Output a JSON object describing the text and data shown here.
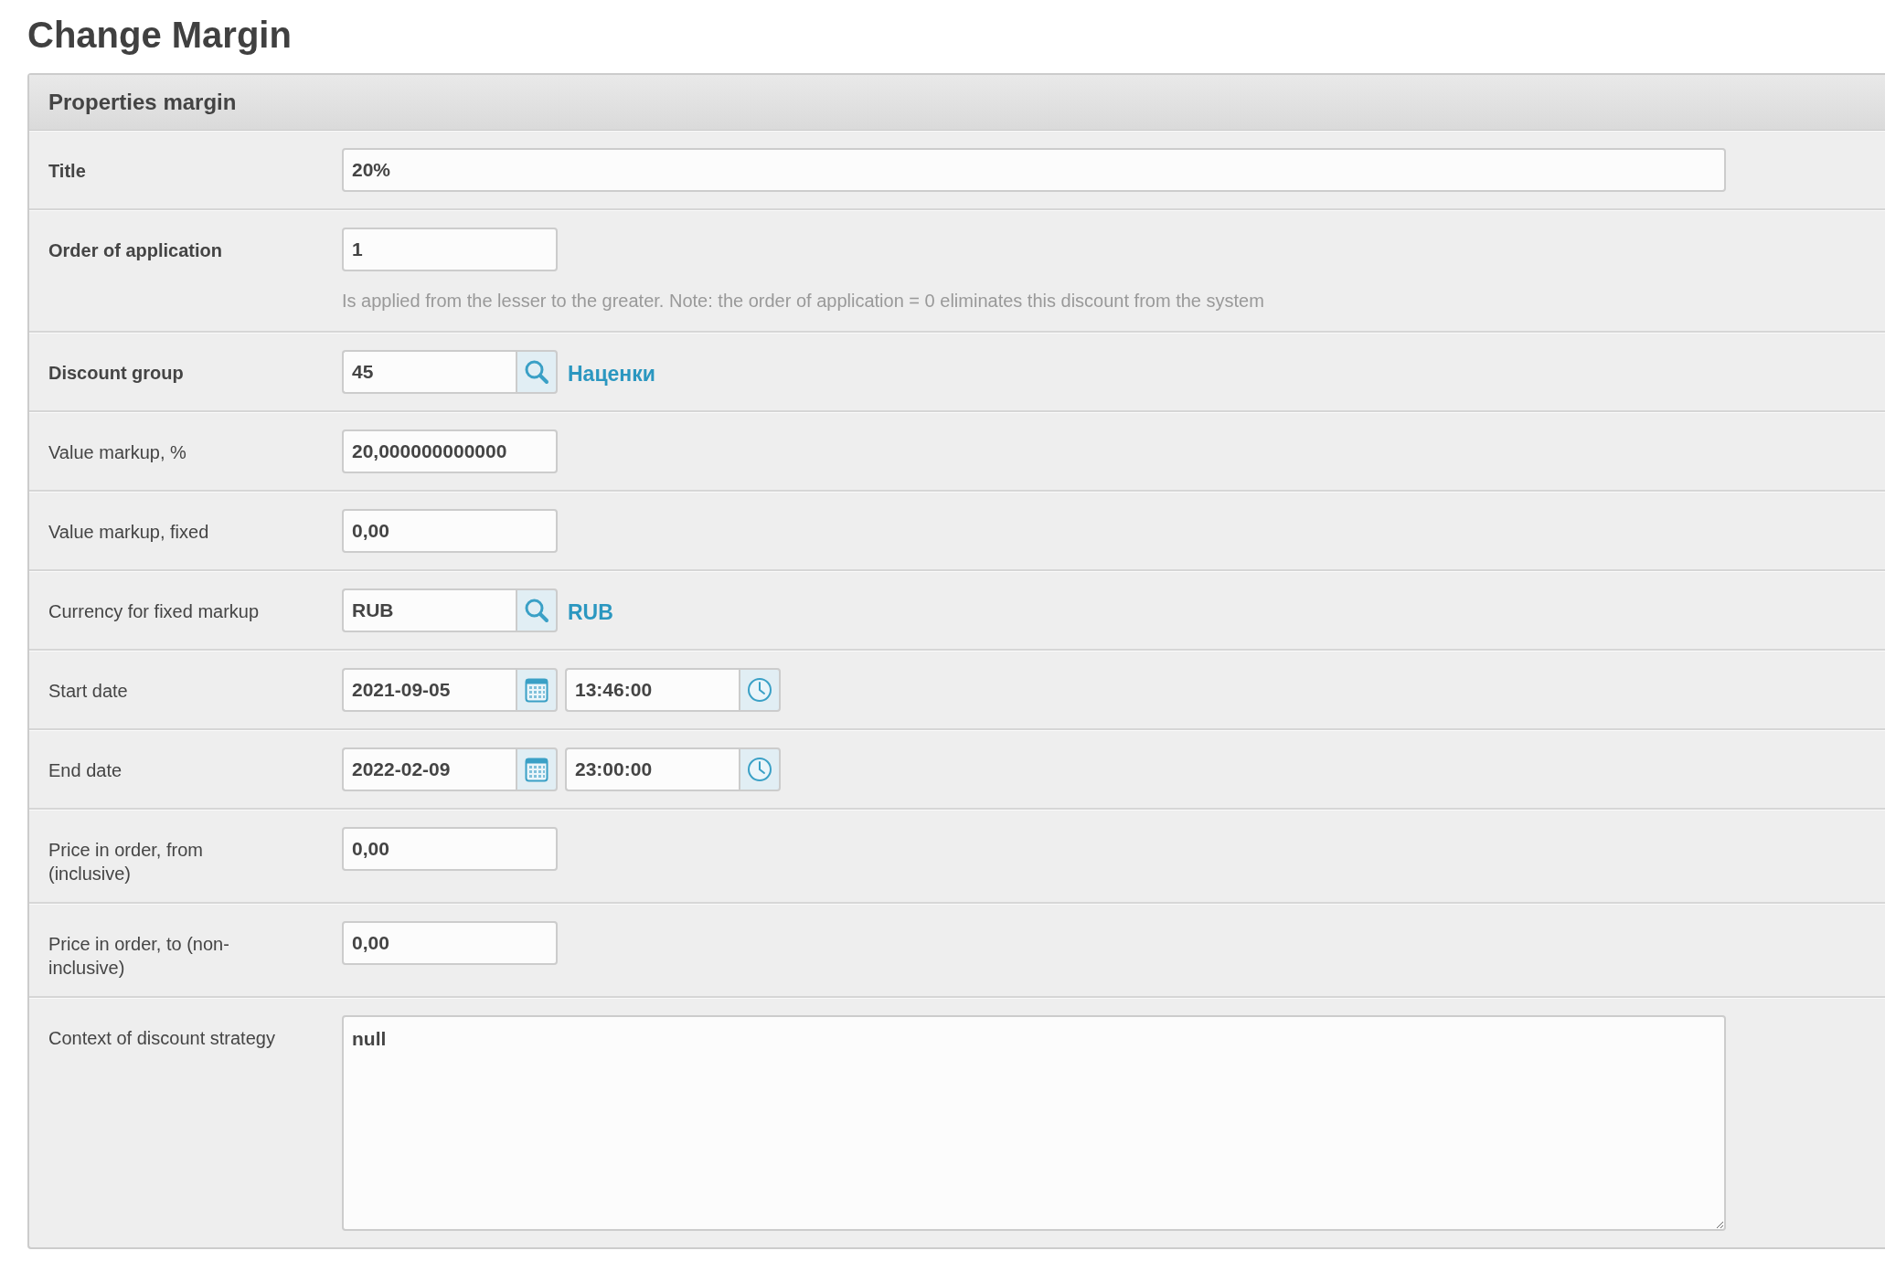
{
  "page_title": "Change Margin",
  "panel": {
    "title": "Properties margin",
    "rows": [
      {
        "kind": "wide_text",
        "label": "Title",
        "bold": true,
        "value": "20%"
      },
      {
        "kind": "text",
        "label": "Order of application",
        "bold": true,
        "value": "1",
        "hint": "Is applied from the lesser to the greater. Note: the order of application = 0 eliminates this discount from the system"
      },
      {
        "kind": "lookup",
        "label": "Discount group",
        "bold": true,
        "value": "45",
        "link": "Наценки"
      },
      {
        "kind": "text",
        "label": "Value markup, %",
        "bold": false,
        "value": "20,000000000000"
      },
      {
        "kind": "text",
        "label": "Value markup, fixed",
        "bold": false,
        "value": "0,00"
      },
      {
        "kind": "lookup",
        "label": "Currency for fixed markup",
        "bold": false,
        "value": "RUB",
        "link": "RUB"
      },
      {
        "kind": "datetime",
        "label": "Start date",
        "bold": false,
        "date": "2021-09-05",
        "time": "13:46:00"
      },
      {
        "kind": "datetime",
        "label": "End date",
        "bold": false,
        "date": "2022-02-09",
        "time": "23:00:00"
      },
      {
        "kind": "text",
        "label": "Price in order, from (inclusive)",
        "bold": false,
        "value": "0,00"
      },
      {
        "kind": "text",
        "label": "Price in order, to (non-inclusive)",
        "bold": false,
        "value": "0,00"
      },
      {
        "kind": "textarea",
        "label": "Context of discount strategy",
        "bold": false,
        "value": "null"
      }
    ]
  }
}
